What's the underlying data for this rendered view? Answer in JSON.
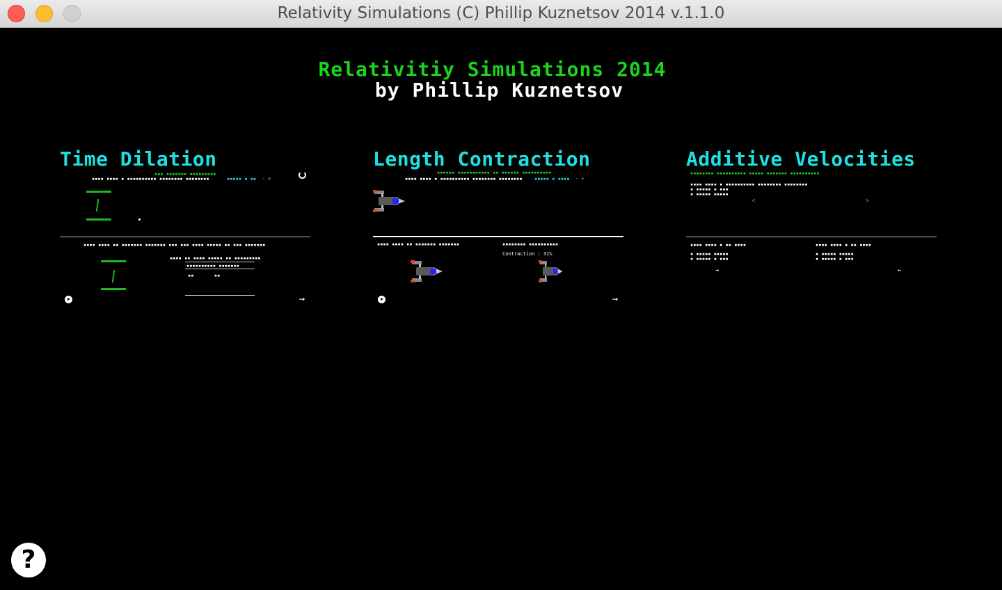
{
  "window": {
    "title": "Relativity Simulations (C) Phillip Kuznetsov 2014 v.1.1.0"
  },
  "header": {
    "title": "Relativitiy Simulations 2014",
    "subtitle": "by Phillip Kuznetsov"
  },
  "panels": {
    "time_dilation": {
      "title": "Time Dilation"
    },
    "length_contraction": {
      "title": "Length Contraction",
      "contraction_label": "Contraction : 31%"
    },
    "additive_velocities": {
      "title": "Additive Velocities"
    }
  },
  "help": {
    "label": "?"
  },
  "icons": {
    "help": "question-mark-icon",
    "play": "play-icon",
    "next": "arrow-right-icon",
    "reset": "reset-icon",
    "ship": "spaceship-icon"
  },
  "colors": {
    "background": "#000000",
    "title_green": "#1bd41b",
    "panel_cyan": "#1ee0e0",
    "clock_green": "#1fb81f"
  }
}
